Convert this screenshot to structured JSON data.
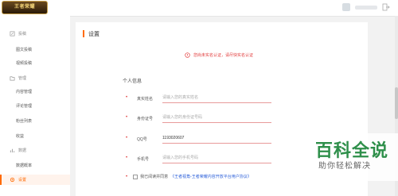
{
  "header": {
    "logo_text": "王者荣耀"
  },
  "sidebar": {
    "groups": [
      {
        "label": "投稿",
        "items": [
          "图文投稿",
          "视频投稿"
        ]
      },
      {
        "label": "管理",
        "items": [
          "内容管理",
          "评论管理",
          "粉丝列表",
          "收益"
        ]
      },
      {
        "label": "数据",
        "items": [
          "数据概率"
        ]
      }
    ],
    "active_label": "设置"
  },
  "main": {
    "title": "设置",
    "warning": "您尚未实名认证，请尽快实名认证",
    "section_title": "个人信息",
    "fields": [
      {
        "label": "真实姓名",
        "value": "",
        "placeholder": "请输入您的真实姓名"
      },
      {
        "label": "身份证号",
        "value": "",
        "placeholder": "请输入您的身份证号码"
      },
      {
        "label": "QQ号",
        "value": "1193020607",
        "placeholder": ""
      },
      {
        "label": "手机号",
        "value": "",
        "placeholder": "请输入您的手机号码"
      }
    ],
    "agree_text": "我已阅读并同意",
    "agree_link": "《王者视角-王者荣耀内容开放平台用户协议》"
  },
  "watermark": {
    "main": "百科全说",
    "sub": "助你轻松解决"
  },
  "colors": {
    "accent": "#ff6a00",
    "warning": "#e23c3c",
    "link": "#2b5fd9"
  }
}
